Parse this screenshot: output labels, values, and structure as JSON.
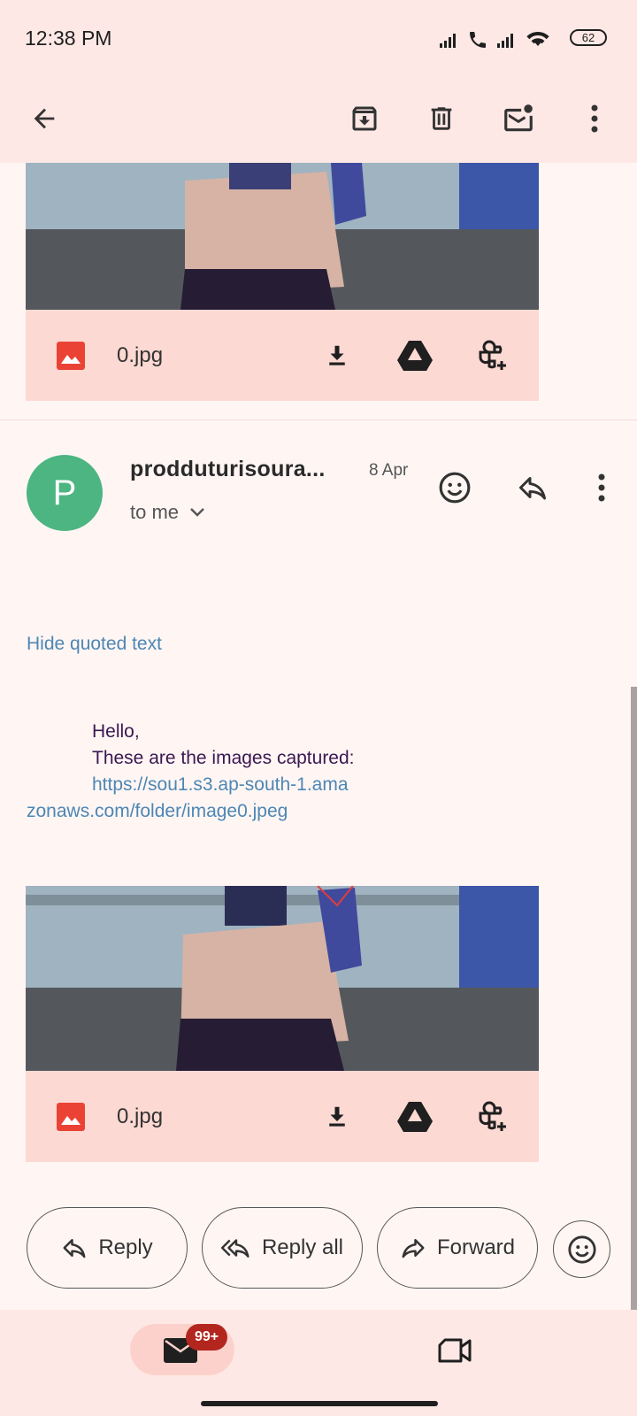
{
  "status": {
    "time": "12:38 PM",
    "battery": "62"
  },
  "toolbar": {
    "back": "back-arrow-icon",
    "archive": "archive-icon",
    "delete": "trash-icon",
    "unread": "mark-unread-icon",
    "more": "more-vert-icon"
  },
  "attachments": [
    {
      "filename": "0.jpg"
    },
    {
      "filename": "0.jpg"
    }
  ],
  "message": {
    "avatar_letter": "P",
    "sender": "prodduturisoura...",
    "date": "8 Apr",
    "recipient_label": "to me",
    "hide_quoted": "Hide quoted text",
    "body": {
      "greeting": "Hello,",
      "line": "These are the images captured:",
      "link_part1": "https://sou1.s3.ap-south-1.ama",
      "link_part2": "zonaws.com/folder/image0.jpeg"
    }
  },
  "actions": {
    "reply": "Reply",
    "reply_all": "Reply all",
    "forward": "Forward"
  },
  "nav": {
    "mail_badge": "99+"
  },
  "colors": {
    "accent": "#4d86b4",
    "avatar": "#4cb581",
    "attachment_bar": "#fdd9d3",
    "header": "#fee8e5",
    "badge": "#b3261e"
  }
}
